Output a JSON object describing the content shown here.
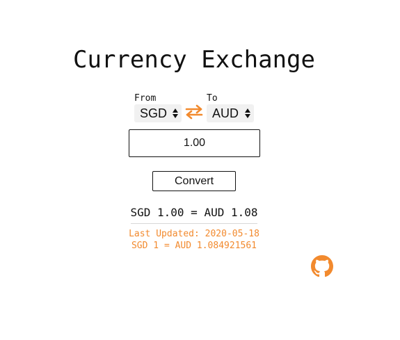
{
  "app": {
    "title": "Currency Exchange"
  },
  "converter": {
    "from_label": "From",
    "to_label": "To",
    "from_currency": "SGD",
    "to_currency": "AUD",
    "amount": "1.00",
    "convert_label": "Convert"
  },
  "result": {
    "text": "SGD 1.00 = AUD 1.08",
    "last_updated": "Last Updated: 2020-05-18",
    "rate_text": "SGD 1 = AUD 1.084921561"
  },
  "icons": {
    "swap": "swap-arrows-icon",
    "github": "github-icon"
  },
  "colors": {
    "accent": "#f28a2e",
    "text": "#111111",
    "select_bg": "#f1f1f1"
  }
}
